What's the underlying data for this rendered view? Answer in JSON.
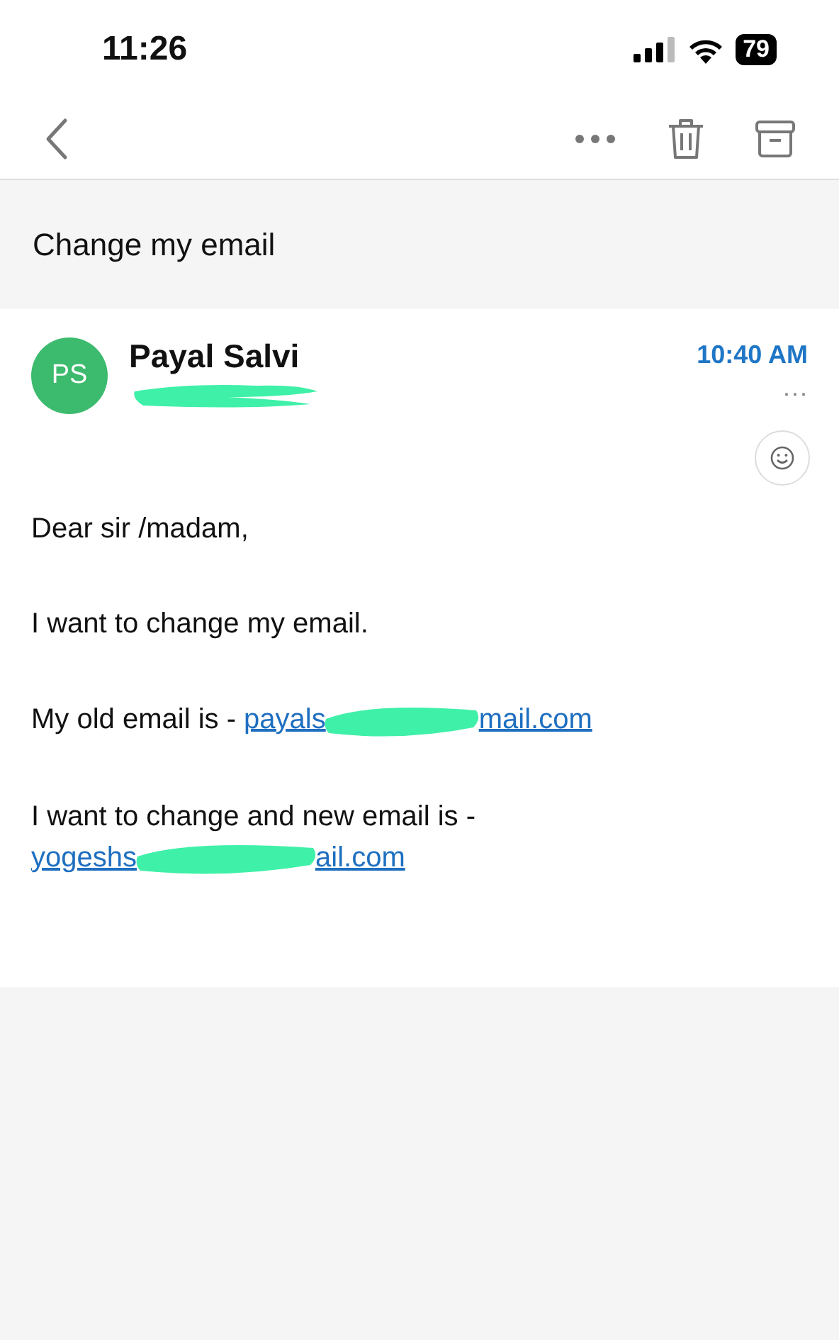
{
  "status_bar": {
    "time": "11:26",
    "battery": "79"
  },
  "subject": "Change my email",
  "message": {
    "avatar": "PS",
    "sender": "Payal Salvi",
    "sender_address_redacted": true,
    "time": "10:40 AM",
    "more": "···",
    "body": [
      {
        "kind": "text",
        "text": "Dear sir /madam,"
      },
      {
        "kind": "text",
        "text": "I want to change my email."
      },
      {
        "kind": "link",
        "text": "My old email is - ",
        "link_start": "payals",
        "link_end": "mail.com"
      },
      {
        "kind": "linkbreak",
        "text": "I want to change and new email is -",
        "link_start": "yogeshs",
        "link_end": "ail.com"
      }
    ]
  }
}
